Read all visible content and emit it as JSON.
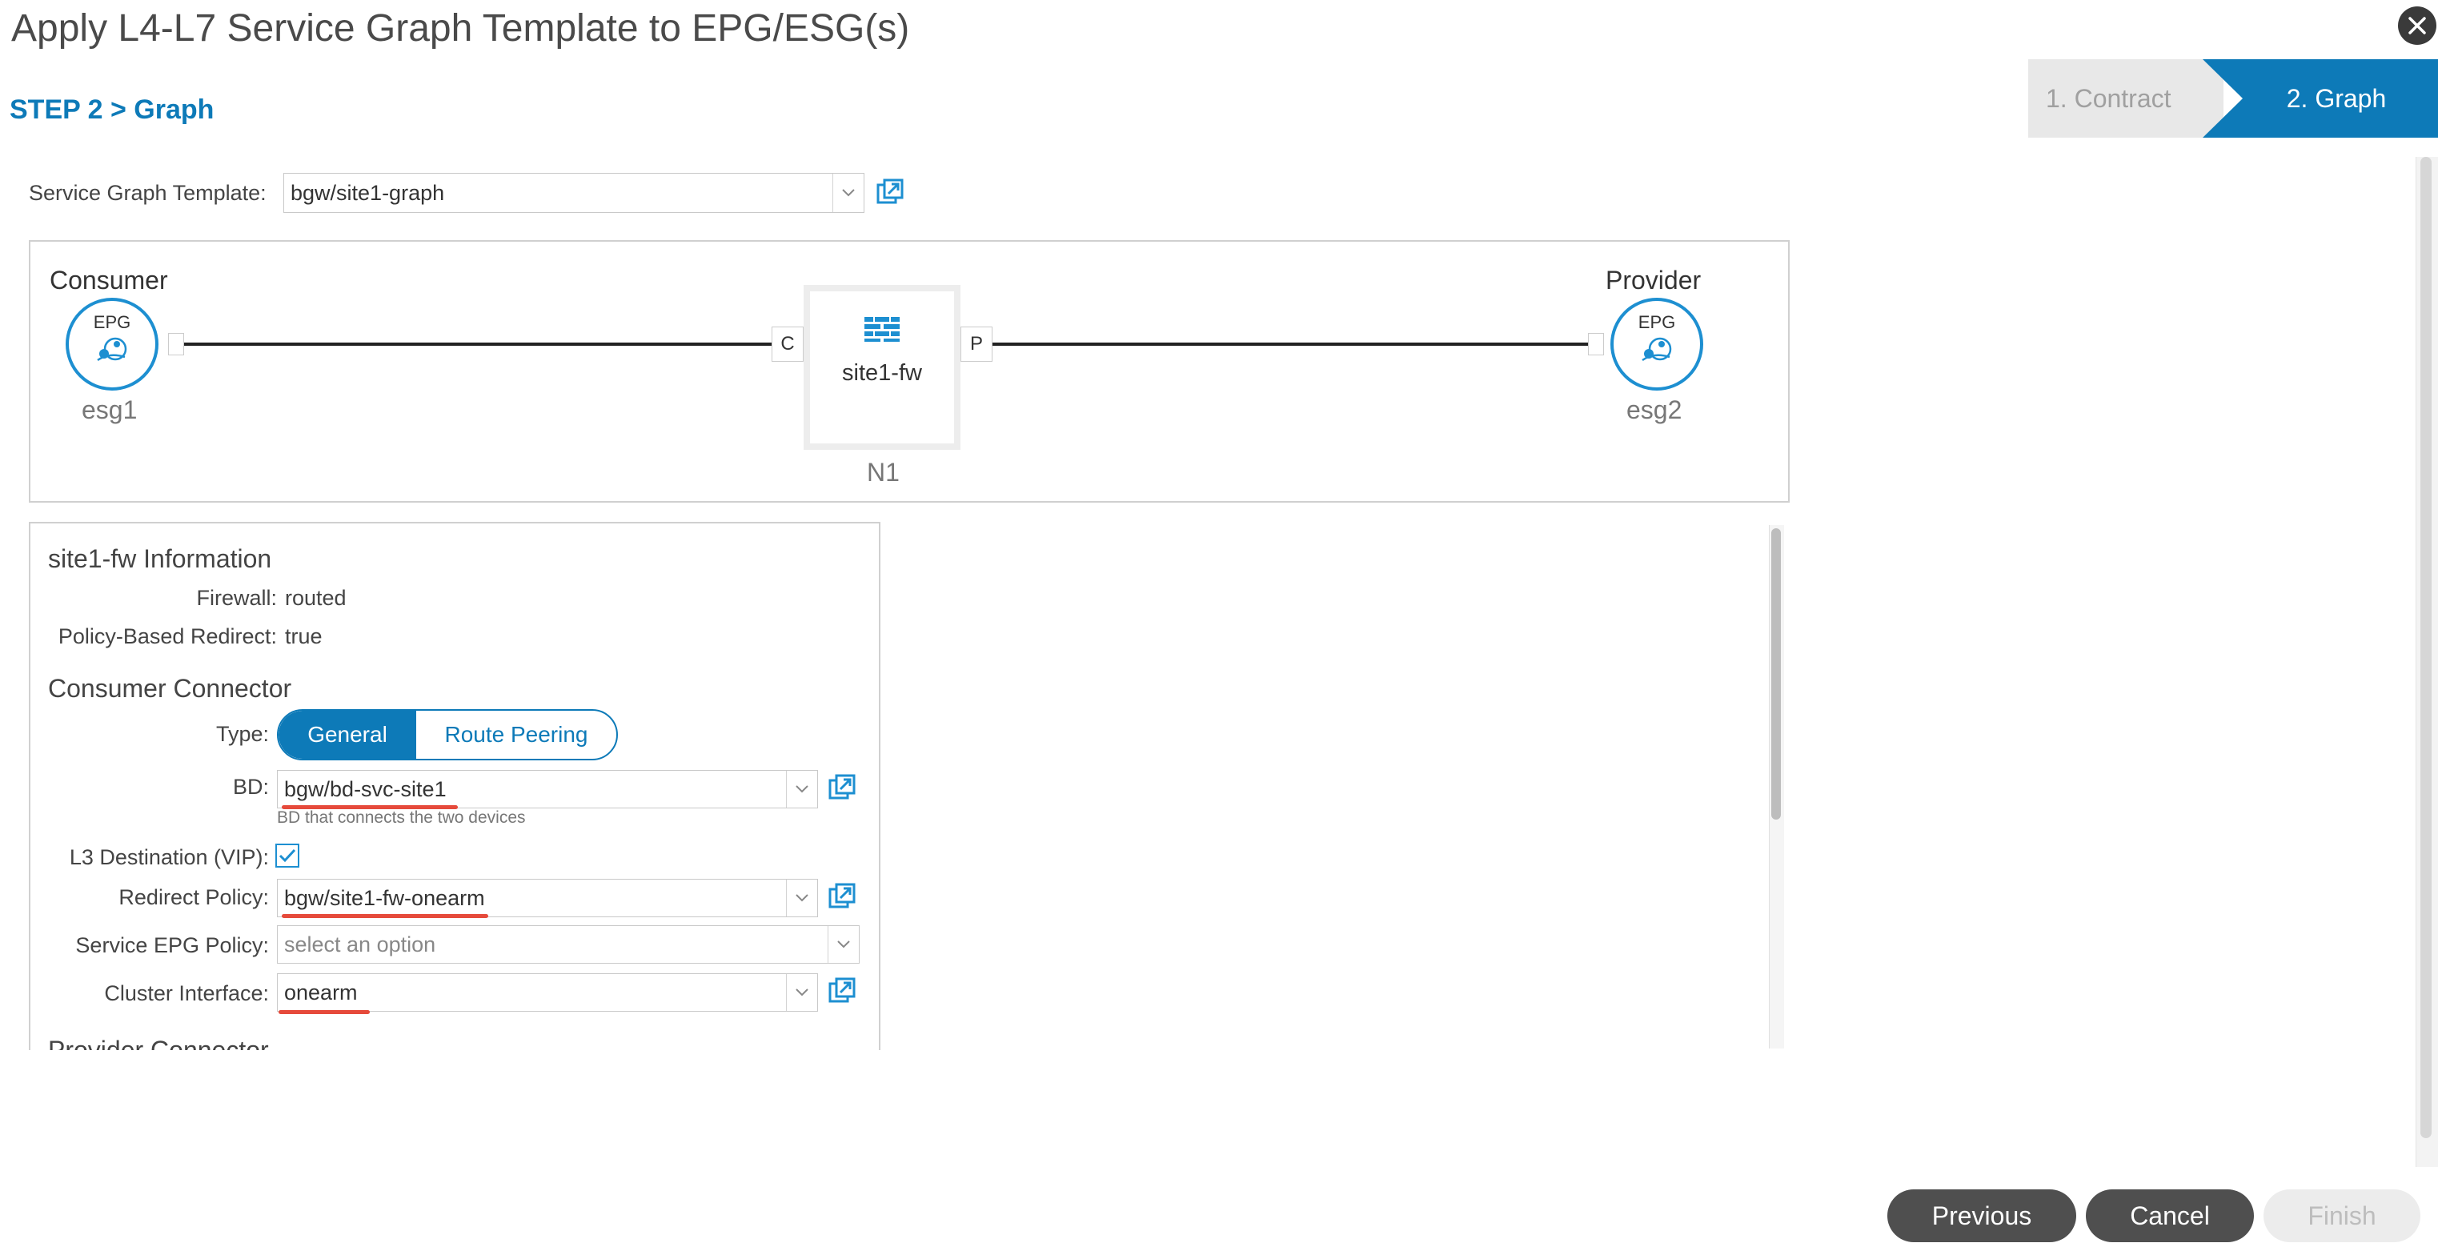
{
  "dialog": {
    "title": "Apply L4-L7 Service Graph Template to EPG/ESG(s)",
    "step_heading": "STEP 2 > Graph"
  },
  "wizard": {
    "steps": [
      {
        "label": "1. Contract",
        "state": "inactive"
      },
      {
        "label": "2. Graph",
        "state": "active"
      }
    ]
  },
  "template_field": {
    "label": "Service Graph Template:",
    "value": "bgw/site1-graph"
  },
  "graph": {
    "consumer": {
      "role": "Consumer",
      "badge": "EPG",
      "name": "esg1"
    },
    "provider": {
      "role": "Provider",
      "badge": "EPG",
      "name": "esg2"
    },
    "device": {
      "name": "site1-fw",
      "node": "N1",
      "consumer_port": "C",
      "provider_port": "P"
    }
  },
  "info": {
    "title": "site1-fw Information",
    "firewall_label": "Firewall:",
    "firewall_value": "routed",
    "pbr_label": "Policy-Based Redirect:",
    "pbr_value": "true",
    "consumer_section": "Consumer Connector",
    "type_label": "Type:",
    "type_options": [
      "General",
      "Route Peering"
    ],
    "type_selected": "General",
    "bd_label": "BD:",
    "bd_value": "bgw/bd-svc-site1",
    "bd_hint": "BD that connects the two devices",
    "l3_label": "L3 Destination (VIP):",
    "l3_checked": true,
    "redirect_label": "Redirect Policy:",
    "redirect_value": "bgw/site1-fw-onearm",
    "service_epg_label": "Service EPG Policy:",
    "service_epg_placeholder": "select an option",
    "cluster_label": "Cluster Interface:",
    "cluster_value": "onearm",
    "provider_section": "Provider Connector"
  },
  "footer": {
    "previous": "Previous",
    "cancel": "Cancel",
    "finish": "Finish"
  },
  "colors": {
    "accent": "#0d7ab8",
    "epg_ring": "#1d8fd1",
    "annotation_underline": "#e64a3b",
    "button_dark": "#4f4f4f"
  }
}
